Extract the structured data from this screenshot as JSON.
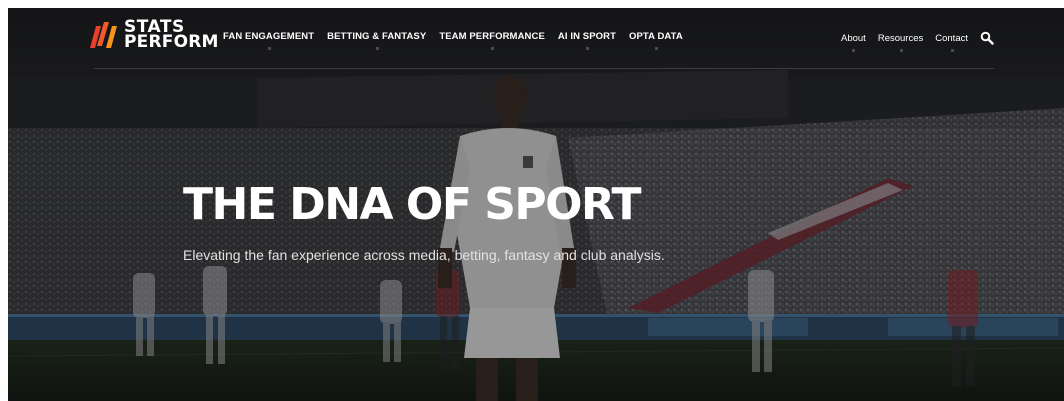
{
  "brand": {
    "logo_line1": "STATS",
    "logo_line2": "PERFORM",
    "logo_mark_colors": [
      "#e8402a",
      "#f7941d"
    ]
  },
  "main_nav": [
    {
      "label": "FAN ENGAGEMENT"
    },
    {
      "label": "BETTING & FANTASY"
    },
    {
      "label": "TEAM PERFORMANCE"
    },
    {
      "label": "AI IN SPORT"
    },
    {
      "label": "OPTA DATA"
    }
  ],
  "utility_nav": [
    {
      "label": "About"
    },
    {
      "label": "Resources"
    },
    {
      "label": "Contact"
    }
  ],
  "search": {
    "icon": "search-icon"
  },
  "hero": {
    "title": "THE DNA OF SPORT",
    "subtitle": "Elevating the fan experience across media, betting, fantasy and club analysis.",
    "background": "football-stadium-photo"
  },
  "colors": {
    "text": "#ffffff",
    "background": "#16181a",
    "accent_red": "#e8402a",
    "accent_orange": "#f7941d"
  }
}
